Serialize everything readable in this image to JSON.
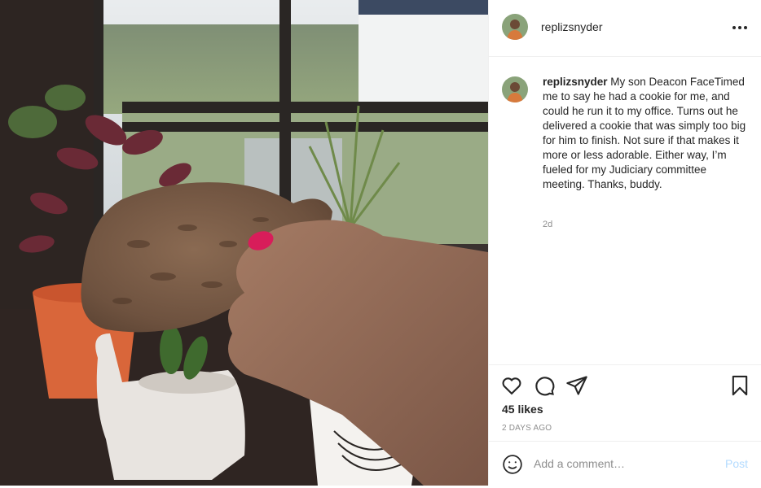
{
  "post": {
    "image_alt": "Hand holding a large cookie in front of a window with plants",
    "username": "replizsnyder",
    "more_icon": "more-horizontal-icon"
  },
  "caption": {
    "username": "replizsnyder",
    "text": "My son Deacon FaceTimed me to say he had a cookie for me, and could he run it to my office. Turns out he delivered a cookie that was simply too big for him to finish. Not sure if that makes it more or less adorable. Either way, I’m fueled for my Judiciary committee meeting. Thanks, buddy.",
    "time": "2d"
  },
  "actions": {
    "like_icon": "heart-icon",
    "comment_icon": "comment-icon",
    "share_icon": "paper-plane-icon",
    "save_icon": "bookmark-icon",
    "likes": "45 likes",
    "date": "2 DAYS AGO"
  },
  "comment_bar": {
    "emoji_icon": "smiley-icon",
    "placeholder": "Add a comment…",
    "post_label": "Post"
  },
  "colors": {
    "post_disabled": "#b3dbff",
    "muted": "#8e8e8e",
    "text": "#262626",
    "divider": "#efefef"
  }
}
